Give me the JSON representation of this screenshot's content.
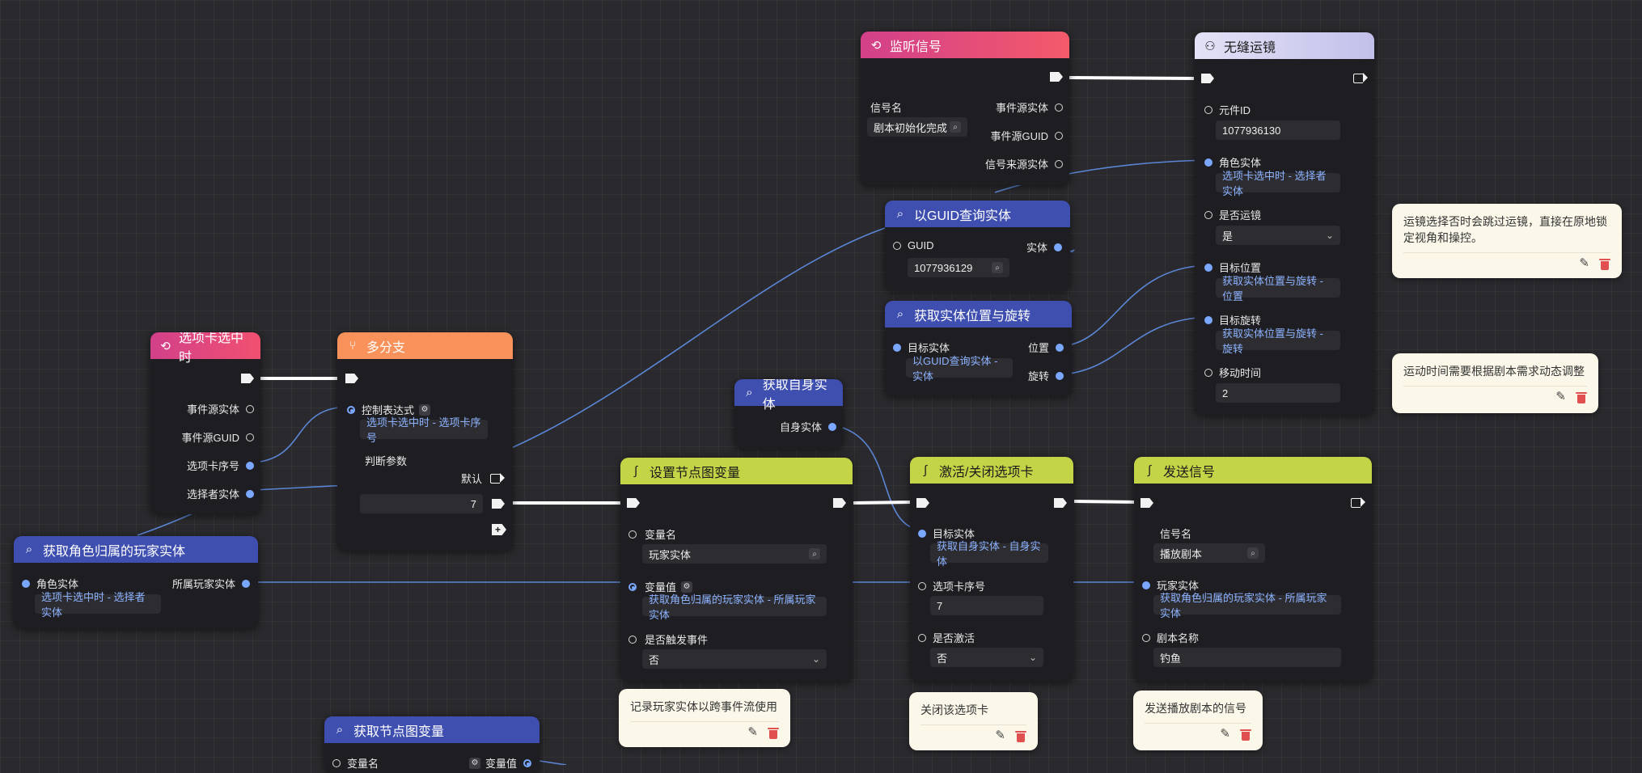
{
  "colors": {
    "pink_header": "#e0407a",
    "orange_header": "#f8925a",
    "blue_header": "#3f4fb0",
    "lime_header": "#c4d447",
    "lilac_header": "#c6c4ee",
    "data_pin": "#7aa7ff",
    "wire_exec": "#ffffff",
    "wire_data": "#5b86d6",
    "comment_bg": "#fbf8ea"
  },
  "nodes": {
    "listen_signal": {
      "title": "监听信号",
      "icon": "loop-icon",
      "signal_name_label": "信号名",
      "signal_name_value": "剧本初始化完成",
      "out1": "事件源实体",
      "out2": "事件源GUID",
      "out3": "信号来源实体"
    },
    "seamless_camera": {
      "title": "无缝运镜",
      "icon": "share-icon",
      "p1": "元件ID",
      "p1_value": "1077936130",
      "p2": "角色实体",
      "p2_value": "选项卡选中时 - 选择者实体",
      "p3": "是否运镜",
      "p3_value": "是",
      "p4": "目标位置",
      "p4_value": "获取实体位置与旋转 - 位置",
      "p5": "目标旋转",
      "p5_value": "获取实体位置与旋转 - 旋转",
      "p6": "移动时间",
      "p6_value": "2"
    },
    "query_guid": {
      "title": "以GUID查询实体",
      "icon": "query-icon",
      "in_label": "GUID",
      "in_value": "1077936129",
      "out_label": "实体"
    },
    "get_transform": {
      "title": "获取实体位置与旋转",
      "icon": "query-icon",
      "in_label": "目标实体",
      "in_value": "以GUID查询实体 - 实体",
      "out1": "位置",
      "out2": "旋转"
    },
    "tab_selected": {
      "title": "选项卡选中时",
      "icon": "loop-icon",
      "out1": "事件源实体",
      "out2": "事件源GUID",
      "out3": "选项卡序号",
      "out4": "选择者实体"
    },
    "multi_branch": {
      "title": "多分支",
      "icon": "branch-icon",
      "ctrl_label": "控制表达式",
      "ctrl_value": "选项卡选中时 - 选项卡序号",
      "param_label": "判断参数",
      "default_label": "默认",
      "case_value": "7"
    },
    "get_self": {
      "title": "获取自身实体",
      "icon": "query-icon",
      "out_label": "自身实体"
    },
    "get_owner_player": {
      "title": "获取角色归属的玩家实体",
      "icon": "query-icon",
      "in_label": "角色实体",
      "in_value": "选项卡选中时 - 选择者实体",
      "out_label": "所属玩家实体"
    },
    "set_graph_var": {
      "title": "设置节点图变量",
      "icon": "flow-icon",
      "p1": "变量名",
      "p1_value": "玩家实体",
      "p2": "变量值",
      "p2_value": "获取角色归属的玩家实体 - 所属玩家实体",
      "p3": "是否触发事件",
      "p3_value": "否"
    },
    "toggle_tab": {
      "title": "激活/关闭选项卡",
      "icon": "flow-icon",
      "p1": "目标实体",
      "p1_value": "获取自身实体 - 自身实体",
      "p2": "选项卡序号",
      "p2_value": "7",
      "p3": "是否激活",
      "p3_value": "否"
    },
    "send_signal": {
      "title": "发送信号",
      "icon": "flow-icon",
      "p1": "信号名",
      "p1_value": "播放剧本",
      "p2": "玩家实体",
      "p2_value": "获取角色归属的玩家实体 - 所属玩家实体",
      "p3": "剧本名称",
      "p3_value": "钓鱼"
    },
    "get_graph_var": {
      "title": "获取节点图变量",
      "icon": "query-icon",
      "in_label": "变量名",
      "out_label": "变量值"
    }
  },
  "comments": {
    "c1": "运镜选择否时会跳过运镜，直接在原地锁定视角和操控。",
    "c2": "运动时间需要根据剧本需求动态调整",
    "c3": "记录玩家实体以跨事件流使用",
    "c4": "关闭该选项卡",
    "c5": "发送播放剧本的信号"
  }
}
